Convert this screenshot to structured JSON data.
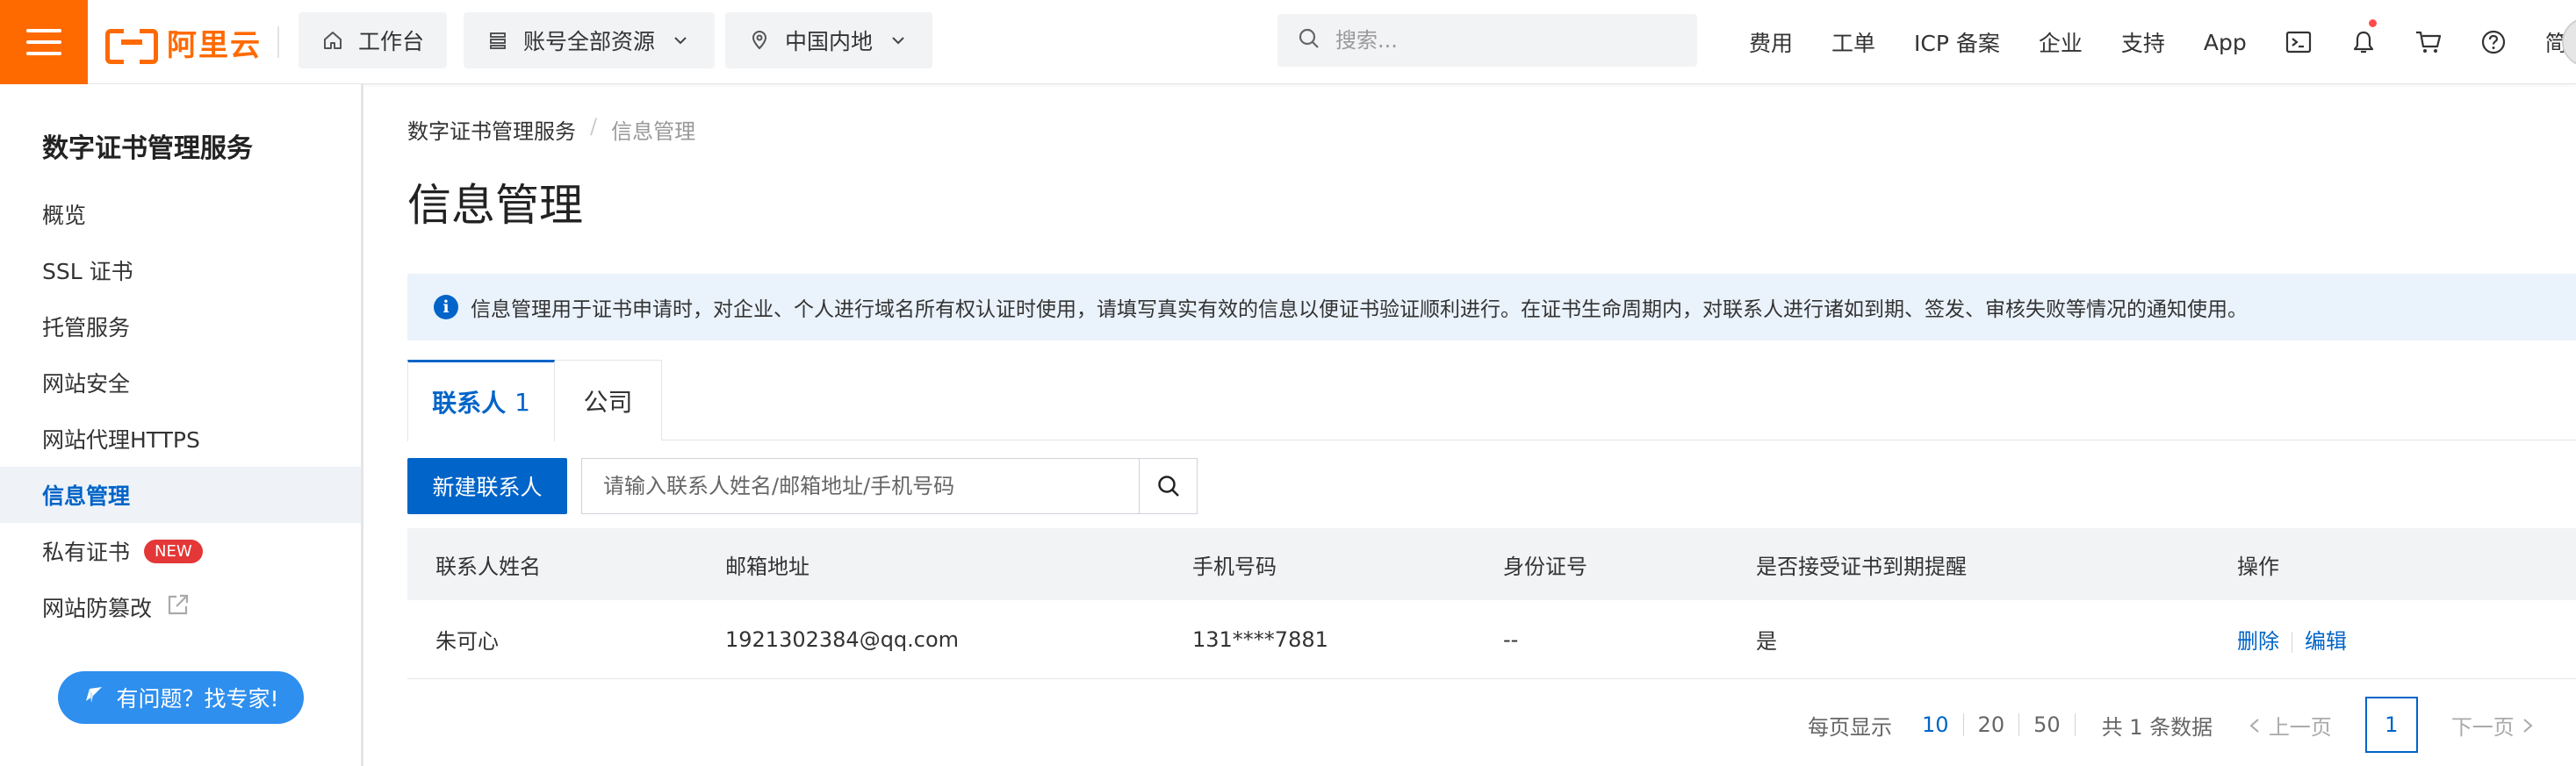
{
  "topbar": {
    "logo_text": "阿里云",
    "workbench": "工作台",
    "resources": "账号全部资源",
    "region": "中国内地",
    "search_placeholder": "搜索...",
    "links": [
      "费用",
      "工单",
      "ICP 备案",
      "企业",
      "支持",
      "App"
    ],
    "lang": "简体",
    "accent_color": "#ff6a00"
  },
  "sidebar": {
    "title": "数字证书管理服务",
    "items": [
      {
        "label": "概览"
      },
      {
        "label": "SSL 证书"
      },
      {
        "label": "托管服务"
      },
      {
        "label": "网站安全"
      },
      {
        "label": "网站代理HTTPS"
      },
      {
        "label": "信息管理"
      },
      {
        "label": "私有证书",
        "badge": "NEW"
      },
      {
        "label": "网站防篡改"
      }
    ],
    "help_button": "有问题？找专家!"
  },
  "main": {
    "breadcrumb": [
      "数字证书管理服务",
      "/",
      "信息管理"
    ],
    "title": "信息管理",
    "notice": "信息管理用于证书申请时，对企业、个人进行域名所有权认证时使用，请填写真实有效的信息以便证书验证顺利进行。在证书生命周期内，对联系人进行诸如到期、签发、审核失败等情况的通知使用。",
    "tabs": [
      {
        "label": "联系人",
        "count": "1"
      },
      {
        "label": "公司"
      }
    ],
    "new_button": "新建联系人",
    "search_placeholder": "请输入联系人姓名/邮箱地址/手机号码",
    "table": {
      "headers": [
        "联系人姓名",
        "邮箱地址",
        "手机号码",
        "身份证号",
        "是否接受证书到期提醒",
        "操作"
      ],
      "rows": [
        {
          "name": "朱可心",
          "email": "1921302384@qq.com",
          "phone": "131****7881",
          "id": "--",
          "remind": "是",
          "delete": "删除",
          "edit": "编辑"
        }
      ]
    },
    "pager": {
      "per_page_label": "每页显示",
      "sizes": [
        "10",
        "20",
        "50"
      ],
      "total": "共 1 条数据",
      "prev": "上一页",
      "current": "1",
      "next": "下一页"
    },
    "primary_color": "#0064c8"
  }
}
